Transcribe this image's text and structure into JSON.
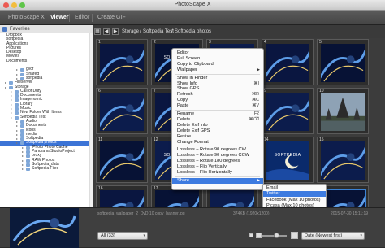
{
  "window": {
    "title": "PhotoScape X"
  },
  "tabs": [
    {
      "label": "PhotoScape X"
    },
    {
      "label": "Viewer"
    },
    {
      "label": "Editor"
    },
    {
      "label": "Create GIF"
    }
  ],
  "sidebar": {
    "header": "Favorites",
    "items": [
      {
        "label": "Dropbox",
        "indent": 0
      },
      {
        "label": "softpedia",
        "indent": 0
      },
      {
        "label": "Applications",
        "indent": 0
      },
      {
        "label": "Pictures",
        "indent": 0
      },
      {
        "label": "Desktop",
        "indent": 0
      },
      {
        "label": "Movies",
        "indent": 0
      },
      {
        "label": "Documents",
        "indent": 0
      },
      {
        "label": "",
        "indent": 0
      },
      {
        "label": "gvcr",
        "indent": 3
      },
      {
        "label": "Shared",
        "indent": 3
      },
      {
        "label": "softpedia",
        "indent": 3
      },
      {
        "label": "Fileserver",
        "indent": 1
      },
      {
        "label": "Storage",
        "indent": 1
      },
      {
        "label": "Call of Duty",
        "indent": 2
      },
      {
        "label": "Documents",
        "indent": 2
      },
      {
        "label": "Imagenomic",
        "indent": 2
      },
      {
        "label": "Library",
        "indent": 2
      },
      {
        "label": "Music",
        "indent": 2
      },
      {
        "label": "New Folder With Items",
        "indent": 2
      },
      {
        "label": "Softpedia Test",
        "indent": 2
      },
      {
        "label": "Audio",
        "indent": 3
      },
      {
        "label": "Documents",
        "indent": 3
      },
      {
        "label": "icons",
        "indent": 3
      },
      {
        "label": "media",
        "indent": 3
      },
      {
        "label": "Softpedia",
        "indent": 3
      },
      {
        "label": "Softpedia photos",
        "indent": 3,
        "selected": true
      },
      {
        "label": "iPhoto Photo Cache",
        "indent": 4
      },
      {
        "label": "PanoramaStudioProject",
        "indent": 4
      },
      {
        "label": "proxy",
        "indent": 4
      },
      {
        "label": "RAW Photos",
        "indent": 4
      },
      {
        "label": "Softpedia_data",
        "indent": 4
      },
      {
        "label": "Softpedia Files",
        "indent": 4
      }
    ]
  },
  "path": {
    "segments": [
      "Storage",
      "Softpedia Test",
      "Softpedia photos"
    ]
  },
  "thumbnails": [
    {
      "num": "1",
      "kind": "wall",
      "text": ""
    },
    {
      "num": "2",
      "kind": "wall",
      "text": "SOFTPEDIA"
    },
    {
      "num": "3",
      "kind": "wall",
      "text": ""
    },
    {
      "num": "4",
      "kind": "wall",
      "text": ""
    },
    {
      "num": "5",
      "kind": "wall",
      "text": ""
    },
    {
      "num": "6",
      "kind": "wall",
      "text": ""
    },
    {
      "num": "7",
      "kind": "wall",
      "text": ""
    },
    {
      "num": "8",
      "kind": "wall",
      "text": ""
    },
    {
      "num": "9",
      "kind": "wall",
      "text": ""
    },
    {
      "num": "10",
      "kind": "tree",
      "text": ""
    },
    {
      "num": "11",
      "kind": "wall",
      "text": ""
    },
    {
      "num": "12",
      "kind": "wall",
      "text": "SOFTPEDIA"
    },
    {
      "num": "13",
      "kind": "wall",
      "text": ""
    },
    {
      "num": "14",
      "kind": "moon",
      "text": "SOFTPEDIA"
    },
    {
      "num": "15",
      "kind": "wall",
      "text": ""
    },
    {
      "num": "16",
      "kind": "wall",
      "text": ""
    },
    {
      "num": "17",
      "kind": "wall",
      "text": ""
    },
    {
      "num": "18",
      "kind": "wall",
      "text": ""
    },
    {
      "num": "19",
      "kind": "wall",
      "text": ""
    },
    {
      "num": "20",
      "kind": "wall",
      "text": ""
    }
  ],
  "context_menu": {
    "items": [
      {
        "label": "Editor",
        "shortcut": ""
      },
      {
        "label": "Full Screen",
        "shortcut": ""
      },
      {
        "label": "Copy to Clipboard",
        "shortcut": ""
      },
      {
        "label": "Wallpaper",
        "shortcut": "",
        "submenu": true
      },
      {
        "sep": true
      },
      {
        "label": "Show in Finder",
        "shortcut": ""
      },
      {
        "label": "Show Info",
        "shortcut": "⌘I"
      },
      {
        "label": "Show GPS",
        "shortcut": ""
      },
      {
        "label": "Refresh",
        "shortcut": "⌘R"
      },
      {
        "label": "Copy",
        "shortcut": "⌘C"
      },
      {
        "label": "Paste",
        "shortcut": "⌘V"
      },
      {
        "sep": true
      },
      {
        "label": "Rename",
        "shortcut": "F2"
      },
      {
        "label": "Delete",
        "shortcut": "⌘⌫"
      },
      {
        "label": "Delete Exif info",
        "shortcut": ""
      },
      {
        "label": "Delete Exif GPS",
        "shortcut": ""
      },
      {
        "label": "Resize",
        "shortcut": ""
      },
      {
        "label": "Change Format",
        "shortcut": ""
      },
      {
        "sep": true
      },
      {
        "label": "Lossless – Rotate 90 degrees CW",
        "shortcut": ""
      },
      {
        "label": "Lossless – Rotate 90 degrees CCW",
        "shortcut": ""
      },
      {
        "label": "Lossless – Rotate 180 degrees",
        "shortcut": ""
      },
      {
        "label": "Lossless – Flip Vertically",
        "shortcut": ""
      },
      {
        "label": "Lossless – Flip Horizontally",
        "shortcut": ""
      },
      {
        "sep": true
      },
      {
        "label": "Share",
        "shortcut": "",
        "submenu": true,
        "highlighted": true
      }
    ]
  },
  "share_menu": {
    "items": [
      {
        "label": "Email"
      },
      {
        "label": "Twitter",
        "highlighted": true
      },
      {
        "label": "Facebook (Max 10 photos)"
      },
      {
        "label": "Picasa (Max 10 photos)"
      },
      {
        "label": "Flickr (Max 10 photos)"
      },
      {
        "sep": true
      },
      {
        "label": "Logout"
      }
    ]
  },
  "status": {
    "filename": "softpedia_wallpaper_2_DvD 10 copy_banner.jpg",
    "dimensions": "374KB (1920x1200)",
    "datetime": "2015-07-30 15:11:19"
  },
  "bottom": {
    "filter_value": "All (33)",
    "sort_value": "Date (Newest first)"
  },
  "colors": {
    "accent": "#3d7be0",
    "background": "#3a3a3a"
  }
}
